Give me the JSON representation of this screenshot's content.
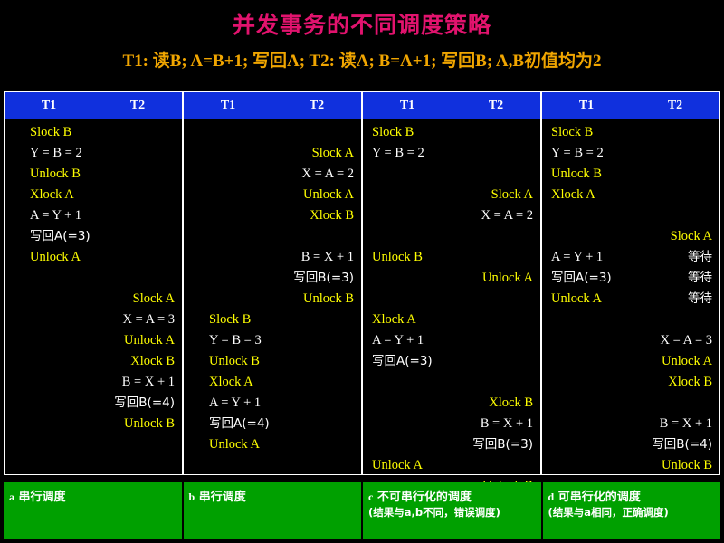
{
  "title": "并发事务的不同调度策略",
  "subtitle": "T1: 读B; A=B+1; 写回A;    T2: 读A; B=A+1; 写回B;   A,B初值均为2",
  "colors": {
    "title": "#e2136e",
    "subtitle": "#f0a500",
    "header_bg": "#1030dd",
    "footer_bg": "#00a000",
    "yellow_text": "#ffff00",
    "white_text": "#ffffff",
    "background": "#000000"
  },
  "columns": [
    {
      "header": {
        "t1": "T1",
        "t2": "T2"
      },
      "rows": [
        {
          "slot": 0,
          "t1": "Slock B",
          "t1c": "y",
          "t2": "",
          "t2c": "y"
        },
        {
          "slot": 1,
          "t1": "Y = B = 2",
          "t1c": "w",
          "t2": "",
          "t2c": "y"
        },
        {
          "slot": 2,
          "t1": "Unlock B",
          "t1c": "y",
          "t2": "",
          "t2c": "y"
        },
        {
          "slot": 3,
          "t1": "Xlock A",
          "t1c": "y",
          "t2": "",
          "t2c": "y"
        },
        {
          "slot": 4,
          "t1": "A = Y + 1",
          "t1c": "w",
          "t2": "",
          "t2c": "y"
        },
        {
          "slot": 5,
          "t1": "写回A(=3)",
          "t1c": "w",
          "t2": "",
          "t2c": "y"
        },
        {
          "slot": 6,
          "t1": "Unlock A",
          "t1c": "y",
          "t2": "",
          "t2c": "y"
        },
        {
          "slot": 8,
          "t1": "",
          "t1c": "y",
          "t2": "Slock A",
          "t2c": "y"
        },
        {
          "slot": 9,
          "t1": "",
          "t1c": "y",
          "t2": "X = A = 3",
          "t2c": "w"
        },
        {
          "slot": 10,
          "t1": "",
          "t1c": "y",
          "t2": "Unlock A",
          "t2c": "y"
        },
        {
          "slot": 11,
          "t1": "",
          "t1c": "y",
          "t2": "Xlock B",
          "t2c": "y"
        },
        {
          "slot": 12,
          "t1": "",
          "t1c": "y",
          "t2": "B = X + 1",
          "t2c": "w"
        },
        {
          "slot": 13,
          "t1": "",
          "t1c": "y",
          "t2": "写回B(=4)",
          "t2c": "w"
        },
        {
          "slot": 14,
          "t1": "",
          "t1c": "y",
          "t2": "Unlock B",
          "t2c": "y"
        }
      ]
    },
    {
      "header": {
        "t1": "T1",
        "t2": "T2"
      },
      "rows": [
        {
          "slot": 1,
          "t1": "",
          "t1c": "y",
          "t2": "Slock A",
          "t2c": "y"
        },
        {
          "slot": 2,
          "t1": "",
          "t1c": "y",
          "t2": "X = A = 2",
          "t2c": "w"
        },
        {
          "slot": 3,
          "t1": "",
          "t1c": "y",
          "t2": "Unlock A",
          "t2c": "y"
        },
        {
          "slot": 4,
          "t1": "",
          "t1c": "y",
          "t2": "Xlock B",
          "t2c": "y"
        },
        {
          "slot": 6,
          "t1": "",
          "t1c": "y",
          "t2": "B = X + 1",
          "t2c": "w"
        },
        {
          "slot": 7,
          "t1": "",
          "t1c": "y",
          "t2": "写回B(=3)",
          "t2c": "w"
        },
        {
          "slot": 8,
          "t1": "",
          "t1c": "y",
          "t2": "Unlock B",
          "t2c": "y"
        },
        {
          "slot": 9,
          "t1": "Slock B",
          "t1c": "y",
          "t2": "",
          "t2c": "y"
        },
        {
          "slot": 10,
          "t1": "Y = B = 3",
          "t1c": "w",
          "t2": "",
          "t2c": "y"
        },
        {
          "slot": 11,
          "t1": "Unlock B",
          "t1c": "y",
          "t2": "",
          "t2c": "y"
        },
        {
          "slot": 12,
          "t1": "Xlock A",
          "t1c": "y",
          "t2": "",
          "t2c": "y"
        },
        {
          "slot": 13,
          "t1": "A = Y + 1",
          "t1c": "w",
          "t2": "",
          "t2c": "y"
        },
        {
          "slot": 14,
          "t1": "写回A(=4)",
          "t1c": "w",
          "t2": "",
          "t2c": "y"
        },
        {
          "slot": 15,
          "t1": "Unlock A",
          "t1c": "y",
          "t2": "",
          "t2c": "y"
        }
      ]
    },
    {
      "header": {
        "t1": "T1",
        "t2": "T2"
      },
      "rows": [
        {
          "slot": 0,
          "t1": "Slock B",
          "t1c": "y",
          "t2": "",
          "t2c": "y"
        },
        {
          "slot": 1,
          "t1": "Y = B = 2",
          "t1c": "w",
          "t2": "",
          "t2c": "y"
        },
        {
          "slot": 3,
          "t1": "",
          "t1c": "y",
          "t2": "Slock A",
          "t2c": "y"
        },
        {
          "slot": 4,
          "t1": "",
          "t1c": "y",
          "t2": "X = A = 2",
          "t2c": "w"
        },
        {
          "slot": 6,
          "t1": "Unlock B",
          "t1c": "y",
          "t2": "",
          "t2c": "y"
        },
        {
          "slot": 7,
          "t1": "",
          "t1c": "y",
          "t2": "Unlock A",
          "t2c": "y"
        },
        {
          "slot": 9,
          "t1": "Xlock A",
          "t1c": "y",
          "t2": "",
          "t2c": "y"
        },
        {
          "slot": 10,
          "t1": "A = Y + 1",
          "t1c": "w",
          "t2": "",
          "t2c": "y"
        },
        {
          "slot": 11,
          "t1": "写回A(=3)",
          "t1c": "w",
          "t2": "",
          "t2c": "y"
        },
        {
          "slot": 13,
          "t1": "",
          "t1c": "y",
          "t2": "Xlock B",
          "t2c": "y"
        },
        {
          "slot": 14,
          "t1": "",
          "t1c": "y",
          "t2": "B = X + 1",
          "t2c": "w"
        },
        {
          "slot": 15,
          "t1": "",
          "t1c": "y",
          "t2": "写回B(=3)",
          "t2c": "w"
        },
        {
          "slot": 16,
          "t1": "Unlock A",
          "t1c": "y",
          "t2": "",
          "t2c": "y"
        },
        {
          "slot": 17,
          "t1": "",
          "t1c": "y",
          "t2": "Unlock B",
          "t2c": "y"
        }
      ]
    },
    {
      "header": {
        "t1": "T1",
        "t2": "T2"
      },
      "rows": [
        {
          "slot": 0,
          "t1": "Slock B",
          "t1c": "y",
          "t2": "",
          "t2c": "y"
        },
        {
          "slot": 1,
          "t1": "Y = B = 2",
          "t1c": "w",
          "t2": "",
          "t2c": "y"
        },
        {
          "slot": 2,
          "t1": "Unlock B",
          "t1c": "y",
          "t2": "",
          "t2c": "y"
        },
        {
          "slot": 3,
          "t1": "Xlock A",
          "t1c": "y",
          "t2": "",
          "t2c": "y"
        },
        {
          "slot": 5,
          "t1": "",
          "t1c": "y",
          "t2": "Slock A",
          "t2c": "y"
        },
        {
          "slot": 6,
          "t1": "A = Y + 1",
          "t1c": "w",
          "t2": "等待",
          "t2c": "w"
        },
        {
          "slot": 7,
          "t1": "写回A(=3)",
          "t1c": "w",
          "t2": "等待",
          "t2c": "w"
        },
        {
          "slot": 8,
          "t1": "Unlock A",
          "t1c": "y",
          "t2": "等待",
          "t2c": "w"
        },
        {
          "slot": 10,
          "t1": "",
          "t1c": "y",
          "t2": "X = A = 3",
          "t2c": "w"
        },
        {
          "slot": 11,
          "t1": "",
          "t1c": "y",
          "t2": "Unlock A",
          "t2c": "y"
        },
        {
          "slot": 12,
          "t1": "",
          "t1c": "y",
          "t2": "Xlock B",
          "t2c": "y"
        },
        {
          "slot": 14,
          "t1": "",
          "t1c": "y",
          "t2": "B = X + 1",
          "t2c": "w"
        },
        {
          "slot": 15,
          "t1": "",
          "t1c": "y",
          "t2": "写回B(=4)",
          "t2c": "w"
        },
        {
          "slot": 16,
          "t1": "",
          "t1c": "y",
          "t2": "Unlock B",
          "t2c": "y"
        }
      ]
    }
  ],
  "footers": [
    {
      "label": "a",
      "main": "串行调度",
      "sub": ""
    },
    {
      "label": "b",
      "main": "串行调度",
      "sub": ""
    },
    {
      "label": "c",
      "main": "不可串行化的调度",
      "sub": "(结果与a,b不同，错误调度)"
    },
    {
      "label": "d",
      "main": "可串行化的调度",
      "sub": "(结果与a相同，正确调度)"
    }
  ]
}
